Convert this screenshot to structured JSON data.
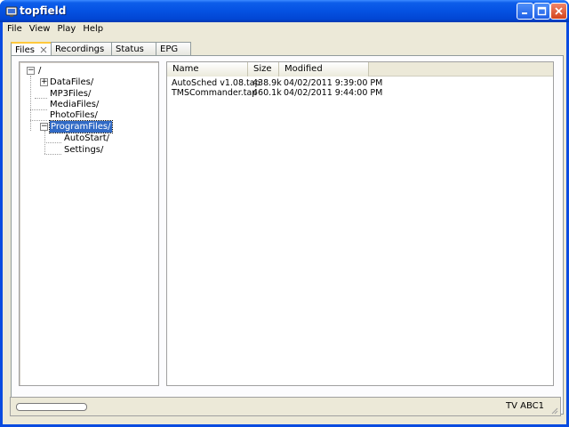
{
  "window": {
    "title": "topfield",
    "colors": {
      "titlebar": "#0553e3",
      "selection": "#316ac5",
      "tab_highlight": "#ffc83c"
    }
  },
  "menu": [
    "File",
    "View",
    "Play",
    "Help"
  ],
  "tabs": [
    {
      "label": "Files",
      "active": true,
      "closable": true
    },
    {
      "label": "Recordings",
      "active": false
    },
    {
      "label": "Status",
      "active": false
    },
    {
      "label": "EPG",
      "active": false
    }
  ],
  "tree": {
    "root": {
      "label": "/",
      "expander": "−"
    },
    "nodes": [
      {
        "label": "DataFiles/",
        "expander": "+"
      },
      {
        "label": "MP3Files/"
      },
      {
        "label": "MediaFiles/"
      },
      {
        "label": "PhotoFiles/"
      },
      {
        "label": "ProgramFiles/",
        "expander": "−",
        "selected": true
      },
      {
        "label": "AutoStart/"
      },
      {
        "label": "Settings/"
      }
    ]
  },
  "file_list": {
    "columns": [
      "Name",
      "Size",
      "Modified"
    ],
    "rows": [
      {
        "name": "AutoSched v1.08.tap",
        "size": "438.9k",
        "modified": "04/02/2011 9:39:00 PM"
      },
      {
        "name": "TMSCommander.tap",
        "size": "460.1k",
        "modified": "04/02/2011 9:44:00 PM"
      }
    ]
  },
  "status": {
    "progress": 0,
    "text": "TV ABC1"
  }
}
